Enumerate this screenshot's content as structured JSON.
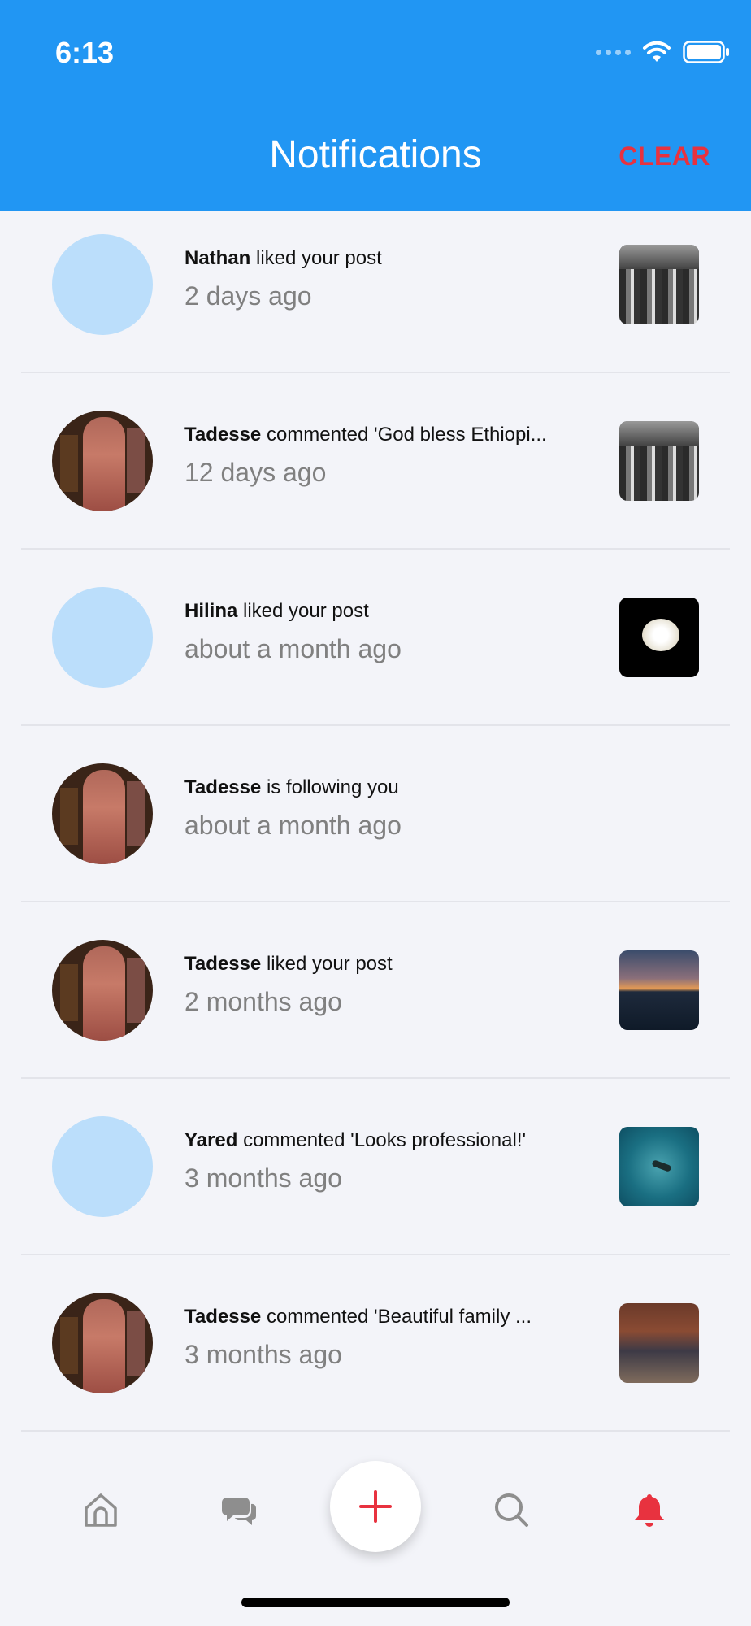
{
  "status_bar": {
    "time": "6:13"
  },
  "header": {
    "title": "Notifications",
    "clear_label": "CLEAR"
  },
  "notifications": [
    {
      "user": "Nathan",
      "action": "liked your post",
      "time": "2 days ago",
      "avatar": "placeholder",
      "thumbnail": "black-and-white-group-photo"
    },
    {
      "user": "Tadesse",
      "action": "commented 'God bless Ethiopi...",
      "time": "12 days ago",
      "avatar": "photo",
      "thumbnail": "black-and-white-group-photo"
    },
    {
      "user": "Hilina",
      "action": "liked your post",
      "time": "about a month ago",
      "avatar": "placeholder",
      "thumbnail": "white-rose-photo"
    },
    {
      "user": "Tadesse",
      "action": "is following you",
      "time": "about a month ago",
      "avatar": "photo",
      "thumbnail": ""
    },
    {
      "user": "Tadesse",
      "action": "liked your post",
      "time": "2 months ago",
      "avatar": "photo",
      "thumbnail": "sunset-sea-photo"
    },
    {
      "user": "Yared",
      "action": "commented 'Looks professional!'",
      "time": "3 months ago",
      "avatar": "placeholder",
      "thumbnail": "underwater-diver-photo"
    },
    {
      "user": "Tadesse",
      "action": "commented 'Beautiful family ...",
      "time": "3 months ago",
      "avatar": "photo",
      "thumbnail": "family-dinner-photo"
    }
  ],
  "tab_bar": {
    "items": [
      "home-icon",
      "chat-bubbles-icon",
      "plus-icon",
      "search-icon",
      "bell-icon"
    ],
    "active": "bell-icon"
  },
  "colors": {
    "header": "#2196f3",
    "accent": "#e8323f",
    "placeholder_avatar": "#bbdefb",
    "inactive_icon": "#8e8e8e"
  }
}
